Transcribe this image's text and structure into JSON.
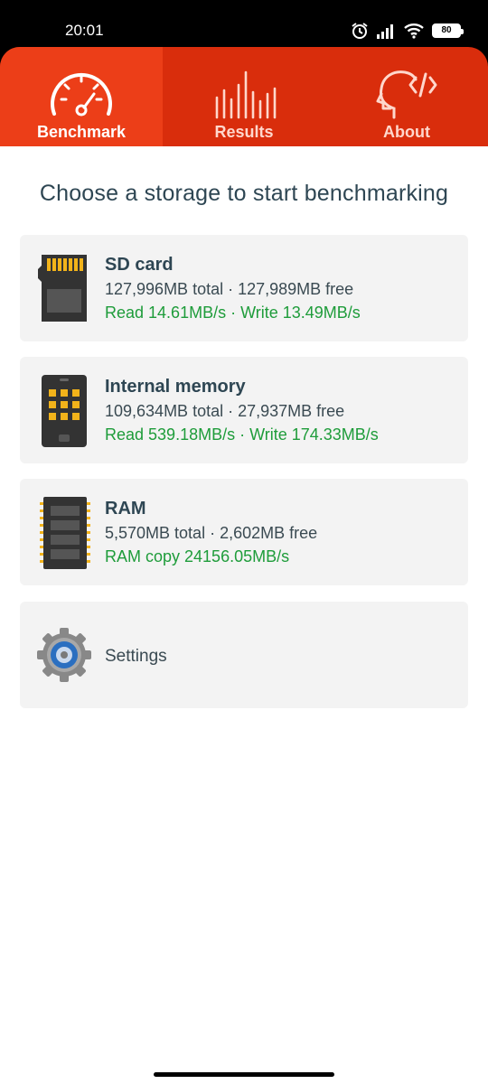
{
  "status": {
    "time": "20:01",
    "battery": "80"
  },
  "tabs": [
    {
      "label": "Benchmark",
      "icon": "speedometer-icon"
    },
    {
      "label": "Results",
      "icon": "bars-icon"
    },
    {
      "label": "About",
      "icon": "head-code-icon"
    }
  ],
  "main": {
    "heading": "Choose a storage to start benchmarking",
    "storages": [
      {
        "title": "SD card",
        "info": "127,996MB total · 127,989MB free",
        "speed": "Read 14.61MB/s · Write 13.49MB/s",
        "icon": "sd-card-icon"
      },
      {
        "title": "Internal memory",
        "info": "109,634MB total · 27,937MB free",
        "speed": "Read 539.18MB/s · Write 174.33MB/s",
        "icon": "phone-memory-icon"
      },
      {
        "title": "RAM",
        "info": "5,570MB total · 2,602MB free",
        "speed": "RAM copy 24156.05MB/s",
        "icon": "ram-chip-icon"
      }
    ],
    "settings": {
      "label": "Settings",
      "icon": "gear-icon"
    }
  },
  "colors": {
    "tab_bg": "#d92d0c",
    "tab_active": "#ec3e18",
    "heading": "#2e4653",
    "speed": "#1e9c3a",
    "card_bg": "#f3f3f3"
  }
}
